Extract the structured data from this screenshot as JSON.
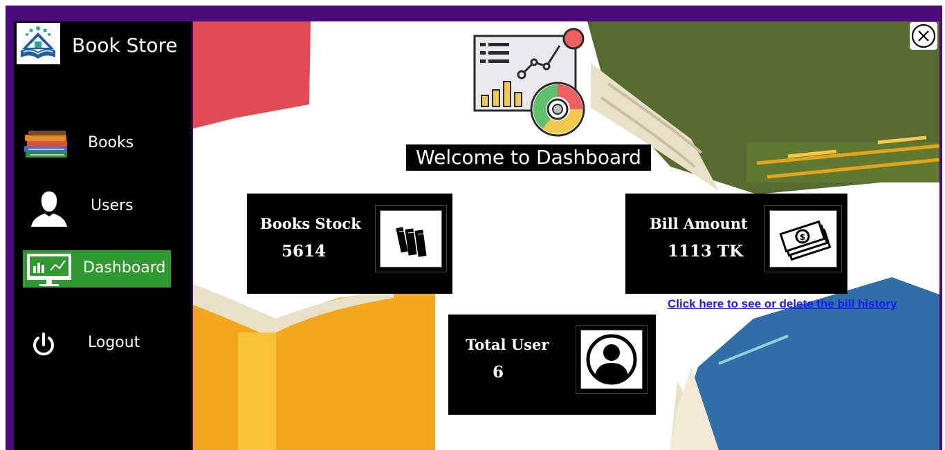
{
  "app": {
    "title": "Book Store",
    "accent_color": "#4b0a7a",
    "sidebar_color": "#000000",
    "active_color": "#2f9a2f"
  },
  "sidebar": {
    "items": [
      {
        "label": "Books",
        "icon": "books-stack-icon",
        "active": false
      },
      {
        "label": "Users",
        "icon": "user-silhouette-icon",
        "active": false
      },
      {
        "label": "Dashboard",
        "icon": "dashboard-monitor-icon",
        "active": true
      },
      {
        "label": "Logout",
        "icon": "power-icon",
        "active": false
      }
    ]
  },
  "main": {
    "welcome": "Welcome to Dashboard",
    "cards": {
      "books_stock": {
        "label": "Books Stock",
        "value": "5614",
        "icon": "books-icon"
      },
      "bill_amount": {
        "label": "Bill Amount",
        "value": "1113  TK",
        "icon": "money-icon"
      },
      "total_user": {
        "label": "Total User",
        "value": "6",
        "icon": "user-avatar-icon"
      }
    },
    "bill_history_link": "Click here to see or delete the bill history"
  }
}
